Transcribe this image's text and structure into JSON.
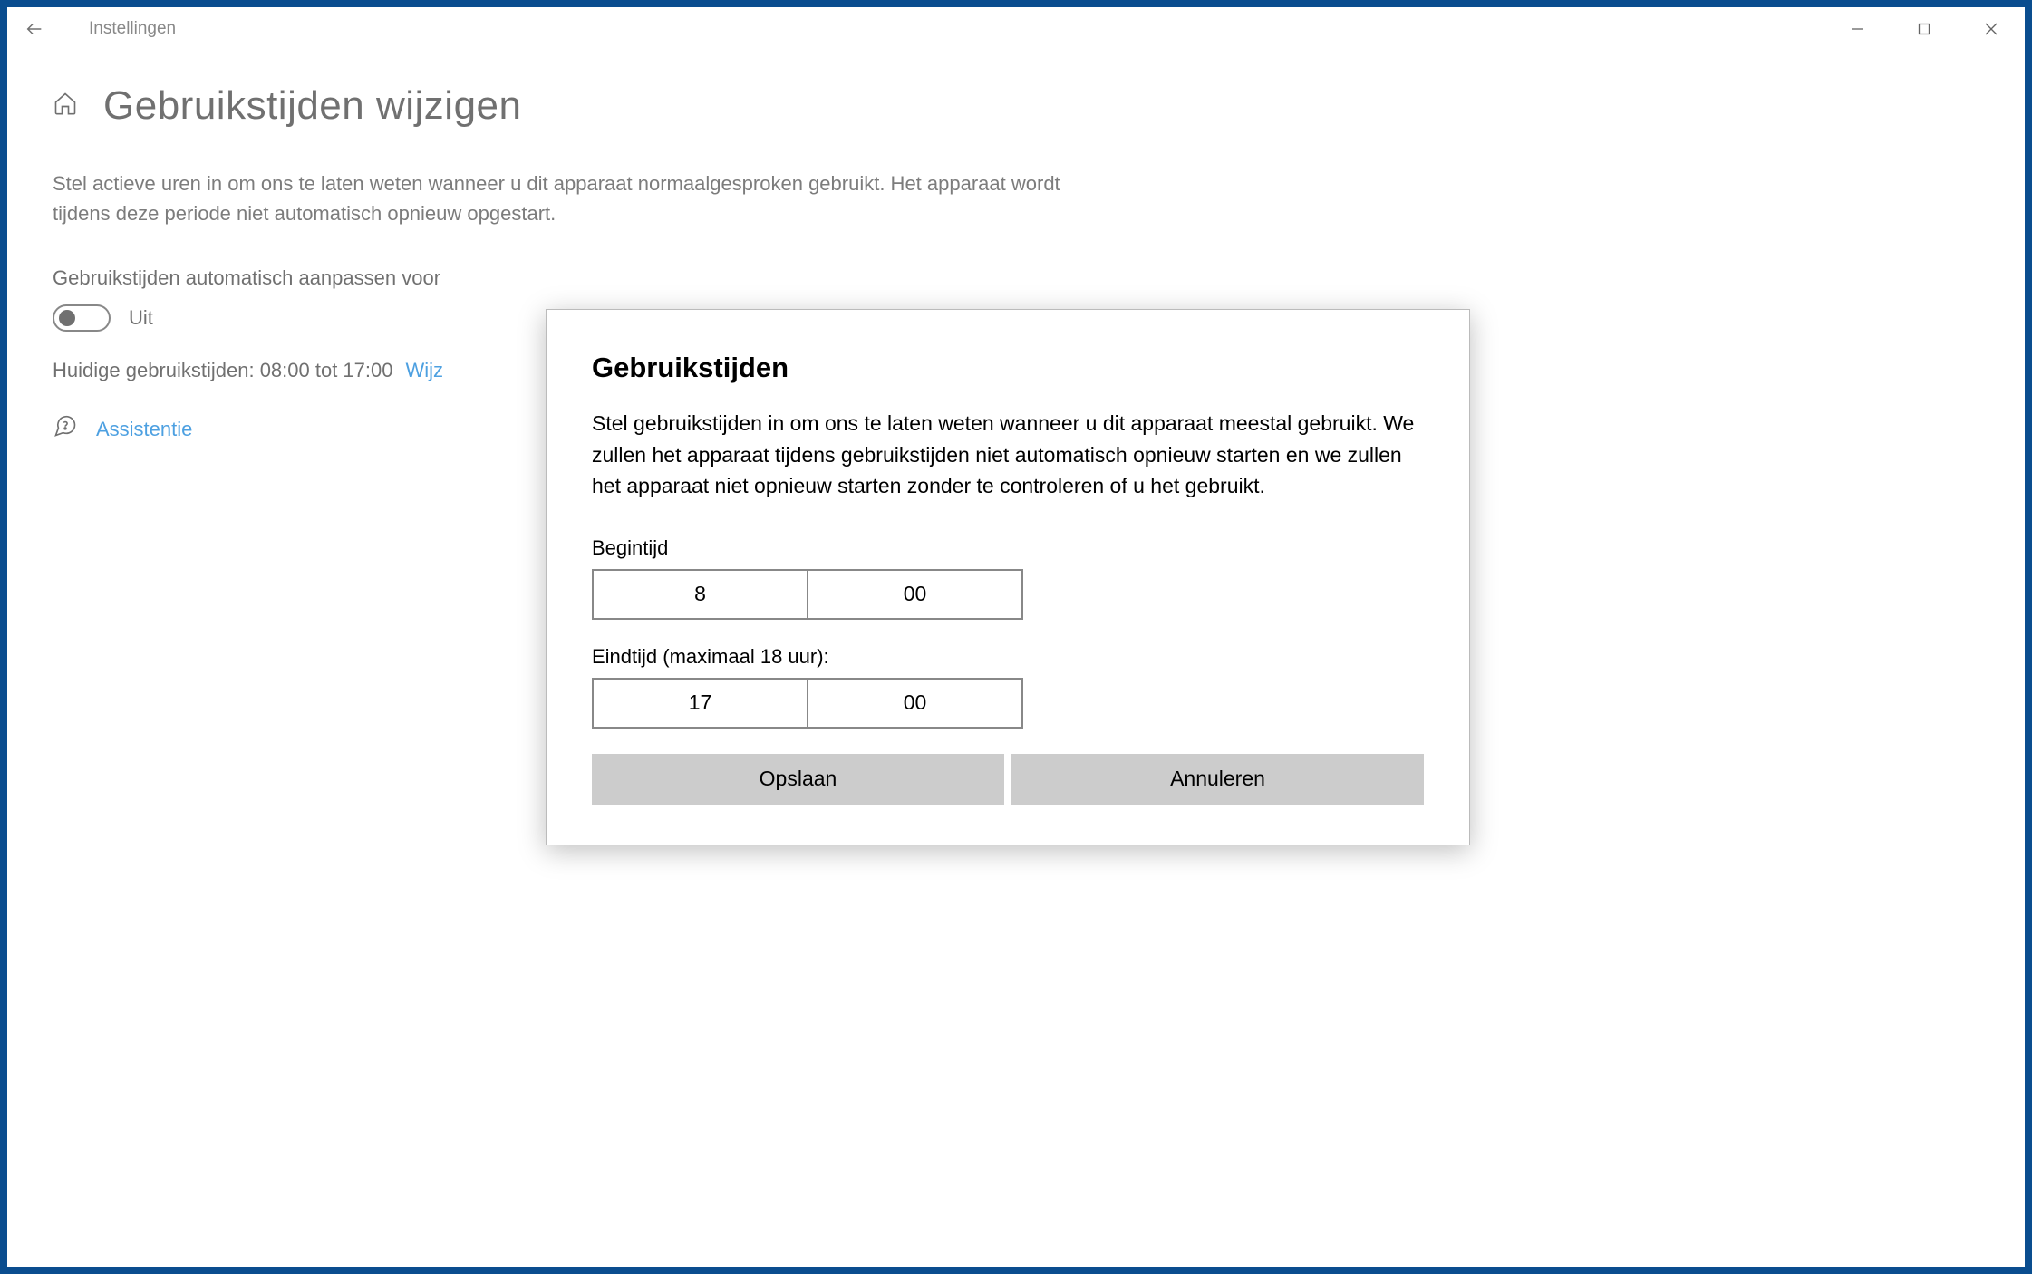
{
  "window": {
    "app_title": "Instellingen"
  },
  "page": {
    "title": "Gebruikstijden wijzigen",
    "description": "Stel actieve uren in om ons te laten weten wanneer u dit apparaat normaalgesproken gebruikt. Het apparaat wordt tijdens deze periode niet automatisch opnieuw opgestart.",
    "auto_adjust_label": "Gebruikstijden automatisch aanpassen voor",
    "toggle_state": "Uit",
    "current_hours": "Huidige gebruikstijden: 08:00 tot 17:00",
    "change_link": "Wijz",
    "help_link": "Assistentie"
  },
  "dialog": {
    "title": "Gebruikstijden",
    "description": "Stel gebruikstijden in om ons te laten weten wanneer u dit apparaat meestal gebruikt. We zullen het apparaat tijdens gebruikstijden niet automatisch opnieuw starten en we zullen het apparaat niet opnieuw starten zonder te controleren of u het gebruikt.",
    "start_label": "Begintijd",
    "start_hour": "8",
    "start_minute": "00",
    "end_label": "Eindtijd (maximaal 18 uur):",
    "end_hour": "17",
    "end_minute": "00",
    "save_button": "Opslaan",
    "cancel_button": "Annuleren"
  }
}
